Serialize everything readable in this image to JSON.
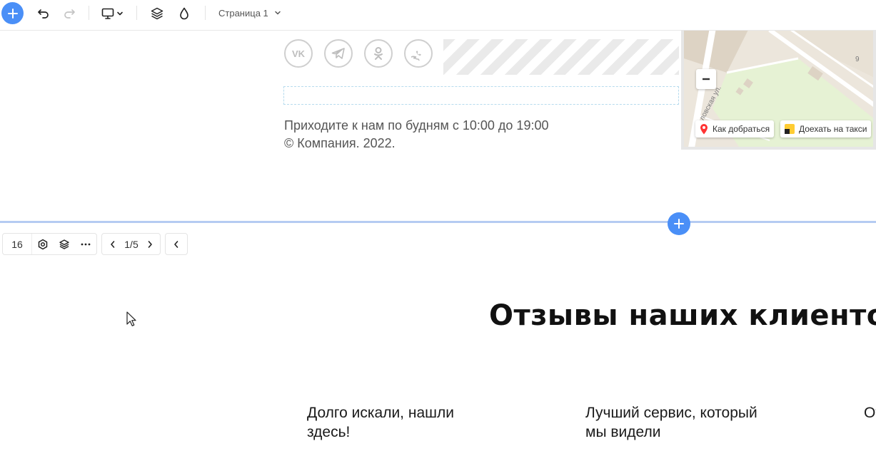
{
  "toolbar": {
    "page_label": "Страница 1",
    "icons": [
      "add-icon",
      "undo-icon",
      "redo-icon",
      "monitor-icon",
      "chevron-down-icon",
      "layers-icon",
      "drop-icon",
      "chevron-down-icon"
    ]
  },
  "footer": {
    "social": [
      {
        "name": "vk-icon",
        "glyph": "VK"
      },
      {
        "name": "telegram-icon",
        "glyph": ""
      },
      {
        "name": "odnoklassniki-icon",
        "glyph": ""
      },
      {
        "name": "viber-icon",
        "glyph": ""
      }
    ],
    "hours": "Приходите к нам по будням с 10:00 до 19:00",
    "copyright": "© Компания. 2022."
  },
  "map": {
    "street_label": "ловская ул.",
    "house_number": "9",
    "route_button": "Как добраться",
    "taxi_button": "Доехать на такси"
  },
  "block_toolbar": {
    "block_number": "16",
    "pagination": "1/5"
  },
  "reviews": {
    "title": "Отзывы наших клиентов",
    "items": [
      {
        "heading_line1": "Долго искали, нашли",
        "heading_line2": "здесь!"
      },
      {
        "heading_line1": "Лучший сервис, который",
        "heading_line2": "мы видели"
      },
      {
        "heading_line1": "От",
        "heading_line2": ""
      }
    ]
  },
  "colors": {
    "accent": "#4a8ff7",
    "divider": "#b5cbf2",
    "map_park": "#e6f2d4"
  }
}
